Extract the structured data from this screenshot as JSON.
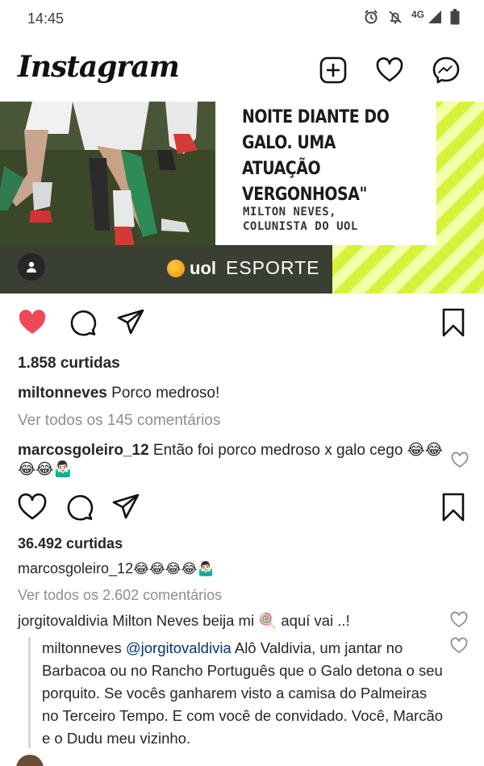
{
  "status_bar": {
    "time": "14:45",
    "network": "4G"
  },
  "header": {
    "logo": "Instagram"
  },
  "post1": {
    "quote": "NOITE DIANTE DO\nGALO. UMA ATUAÇÃO\nVERGONHOSA\"",
    "author": "MILTON NEVES,\nCOLUNISTA DO UOL",
    "brand": "uol",
    "brand_section": "ESPORTE",
    "liked": true,
    "likes": "1.858 curtidas",
    "caption_user": "miltonneves",
    "caption_text": "Porco medroso!",
    "view_all": "Ver todos os 145 comentários",
    "comment_user": "marcosgoleiro_12",
    "comment_text": "Então foi porco medroso x galo cego 😂😂😂😂🤷🏻‍♂️"
  },
  "post2": {
    "liked": false,
    "likes": "36.492 curtidas",
    "caption_user": "marcosgoleiro_12",
    "caption_text": "😂😂😂😂🤷🏻‍♂️",
    "view_all": "Ver todos os 2.602 comentários",
    "comment_user": "jorgitovaldivia",
    "comment_text": "Milton Neves beija mi 🍭  aquí vai ..!",
    "reply_user": "miltonneves",
    "reply_mention": "@jorgitovaldivia",
    "reply_text": "Alô Valdivia, um jantar no Barbacoa ou no Rancho Português que o Galo detona o seu porquito. Se vocês ganharem visto a camisa do Palmeiras no Terceiro Tempo. E com você de convidado. Você, Marcão e o Dudu meu vizinho."
  },
  "colors": {
    "like_red": "#ed4956",
    "link_blue": "#00376b",
    "muted": "#8e8e8e"
  },
  "icons": [
    "alarm-icon",
    "bell-off-icon",
    "signal-icon",
    "battery-icon",
    "add-post-icon",
    "heart-icon",
    "messenger-icon",
    "comment-icon",
    "share-icon",
    "bookmark-icon",
    "user-tag-icon"
  ]
}
